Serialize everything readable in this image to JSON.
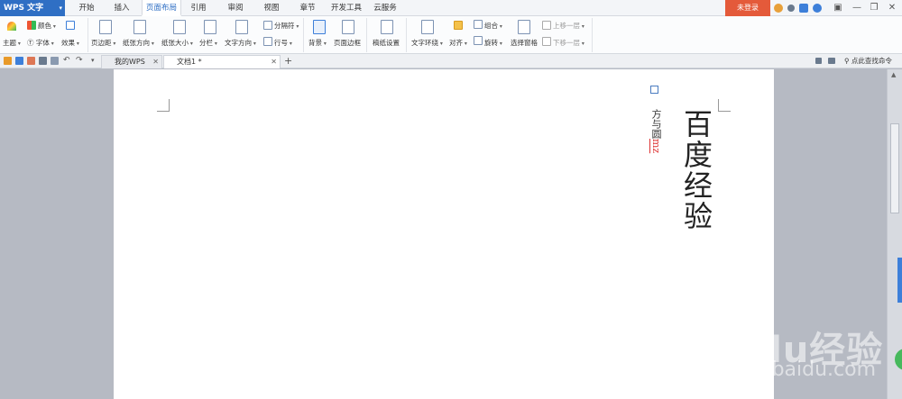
{
  "app": {
    "name": "WPS 文字",
    "login": "未登录"
  },
  "menu_tabs": [
    "开始",
    "插入",
    "页面布局",
    "引用",
    "审阅",
    "视图",
    "章节",
    "开发工具",
    "云服务"
  ],
  "ribbon": {
    "theme": "主题",
    "color": "颜色",
    "font": "字体",
    "effect": "效果",
    "margins": "页边距",
    "orientation": "纸张方向",
    "size": "纸张大小",
    "columns": "分栏",
    "text_direction": "文字方向",
    "breaks": "分隔符",
    "line_numbers": "行号",
    "background": "背景",
    "page_border": "页面边框",
    "manuscript": "稿纸设置",
    "text_wrap": "文字环绕",
    "align": "对齐",
    "group": "组合",
    "rotate": "旋转",
    "selection_pane": "选择窗格",
    "bring_forward": "上移一层",
    "send_backward": "下移一层"
  },
  "tabs": {
    "mywps": "我的WPS",
    "doc1": "文档1 *",
    "search": "点此查找命令"
  },
  "document": {
    "title": "百度经验",
    "subtitle": "方与圆",
    "mark": "mz"
  },
  "watermark": {
    "main": "Baidu经验",
    "sub": "jingyan.baidu.com"
  },
  "colors": {
    "accent": "#2f6fc4",
    "login": "#e45a3a"
  }
}
